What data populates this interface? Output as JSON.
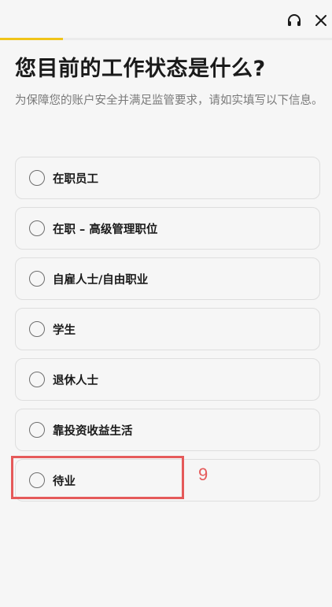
{
  "header": {
    "support_icon": "headset-icon",
    "close_icon": "close-icon",
    "progress_fraction": 0.19,
    "progress_color": "#f0c419"
  },
  "page": {
    "title": "您目前的工作状态是什么?",
    "subtitle": "为保障您的账户安全并满足监管要求，请如实填写以下信息。"
  },
  "options": [
    {
      "label": "在职员工"
    },
    {
      "label": "在职 – 高级管理职位"
    },
    {
      "label": "自雇人士/自由职业"
    },
    {
      "label": "学生"
    },
    {
      "label": "退休人士"
    },
    {
      "label": "靠投资收益生活"
    },
    {
      "label": "待业"
    }
  ],
  "annotation": {
    "number": "9",
    "color": "#e55a5a"
  }
}
